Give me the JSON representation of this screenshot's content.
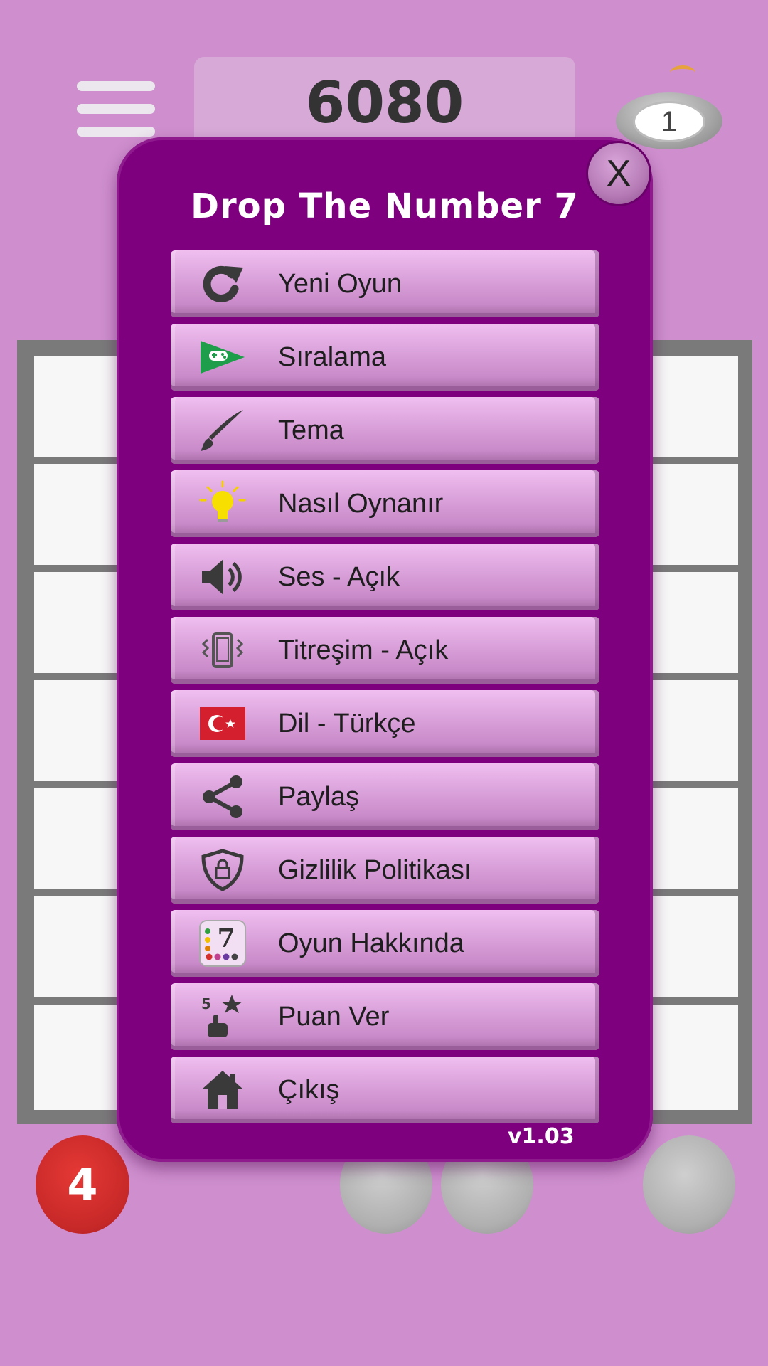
{
  "header": {
    "score": "6080",
    "bomb_count": "1"
  },
  "modal": {
    "title": "Drop The Number 7",
    "close_label": "X",
    "version": "v1.03",
    "items": [
      {
        "label": "Yeni Oyun",
        "icon": "restart-icon"
      },
      {
        "label": "Sıralama",
        "icon": "play-games-controller-icon"
      },
      {
        "label": "Tema",
        "icon": "brush-icon"
      },
      {
        "label": "Nasıl Oynanır",
        "icon": "lightbulb-icon"
      },
      {
        "label": "Ses - Açık",
        "icon": "speaker-icon"
      },
      {
        "label": "Titreşim - Açık",
        "icon": "vibration-icon"
      },
      {
        "label": "Dil - Türkçe",
        "icon": "turkey-flag-icon"
      },
      {
        "label": "Paylaş",
        "icon": "share-icon"
      },
      {
        "label": "Gizlilik Politikası",
        "icon": "privacy-shield-icon"
      },
      {
        "label": "Oyun Hakkında",
        "icon": "app-logo-icon"
      },
      {
        "label": "Puan Ver",
        "icon": "rate-star-icon"
      },
      {
        "label": "Çıkış",
        "icon": "home-icon"
      }
    ]
  },
  "next_ball": {
    "value": "4",
    "color": "#d32f2f"
  },
  "colors": {
    "background": "#cf8fcf",
    "modal": "#7e007e",
    "menu_button": "#d9a0d9"
  }
}
